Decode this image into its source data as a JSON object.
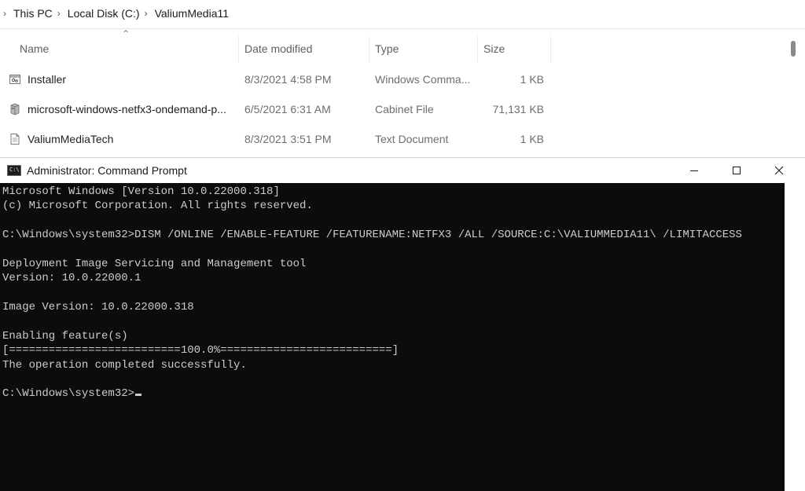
{
  "explorer": {
    "breadcrumb": [
      "This PC",
      "Local Disk (C:)",
      "ValiumMedia11"
    ],
    "columns": {
      "name": "Name",
      "date": "Date modified",
      "type": "Type",
      "size": "Size"
    },
    "files": [
      {
        "name": "Installer",
        "date": "8/3/2021 4:58 PM",
        "type": "Windows Comma...",
        "size": "1 KB",
        "icon": "script-file-icon"
      },
      {
        "name": "microsoft-windows-netfx3-ondemand-p...",
        "date": "6/5/2021 6:31 AM",
        "type": "Cabinet File",
        "size": "71,131 KB",
        "icon": "cabinet-file-icon"
      },
      {
        "name": "ValiumMediaTech",
        "date": "8/3/2021 3:51 PM",
        "type": "Text Document",
        "size": "1 KB",
        "icon": "text-file-icon"
      }
    ]
  },
  "cmd": {
    "title": "Administrator: Command Prompt",
    "lines": [
      "Microsoft Windows [Version 10.0.22000.318]",
      "(c) Microsoft Corporation. All rights reserved.",
      "",
      "C:\\Windows\\system32>DISM /ONLINE /ENABLE-FEATURE /FEATURENAME:NETFX3 /ALL /SOURCE:C:\\VALIUMMEDIA11\\ /LIMITACCESS",
      "",
      "Deployment Image Servicing and Management tool",
      "Version: 10.0.22000.1",
      "",
      "Image Version: 10.0.22000.318",
      "",
      "Enabling feature(s)",
      "[==========================100.0%==========================]",
      "The operation completed successfully.",
      "",
      "C:\\Windows\\system32>"
    ]
  },
  "colors": {
    "console_bg": "#0c0c0c",
    "console_text": "#cccccc",
    "titlebar_bg": "#ffffff"
  }
}
